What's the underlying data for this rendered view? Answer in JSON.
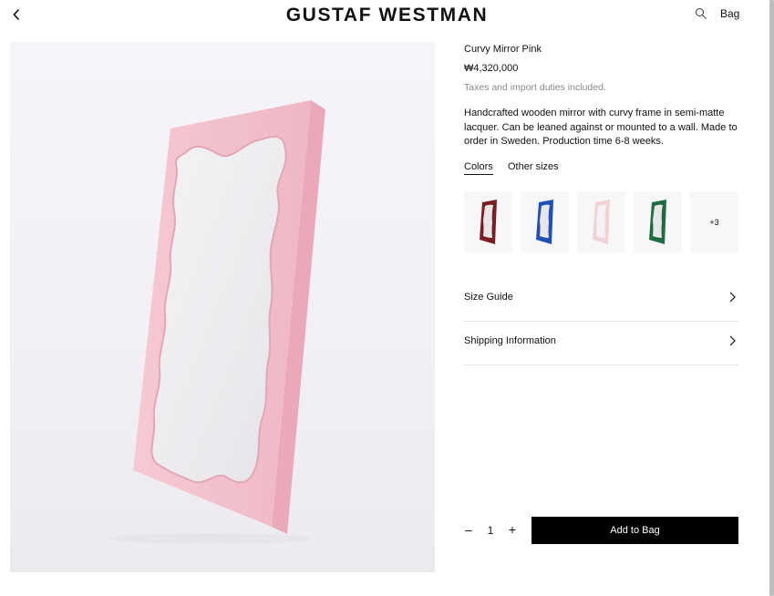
{
  "brand": {
    "logo": "GUSTAF WESTMAN"
  },
  "header": {
    "bag_label": "Bag",
    "search_icon": "search-icon",
    "back_icon": "chevron-left-icon"
  },
  "product": {
    "name": "Curvy Mirror Pink",
    "price": "₩4,320,000",
    "tax_note": "Taxes and import duties included.",
    "description": "Handcrafted wooden mirror with curvy frame in semi-matte lacquer. Can be leaned against or mounted to a wall. Made to order in Sweden. Production time 6-8 weeks.",
    "image_color": "#f2c3cf"
  },
  "tabs": [
    {
      "label": "Colors",
      "active": true
    },
    {
      "label": "Other sizes",
      "active": false
    }
  ],
  "swatches": [
    {
      "color": "#7a1e24"
    },
    {
      "color": "#1f4fb8"
    },
    {
      "color": "#efd3d6"
    },
    {
      "color": "#1d6b3e"
    },
    {
      "more_label": "+3"
    }
  ],
  "accordion": [
    {
      "label": "Size Guide"
    },
    {
      "label": "Shipping Information"
    }
  ],
  "cart": {
    "minus": "–",
    "quantity": "1",
    "plus": "+",
    "add_label": "Add to Bag"
  }
}
